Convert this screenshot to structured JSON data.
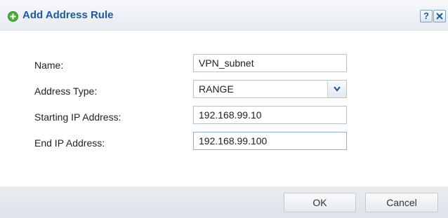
{
  "dialog": {
    "title": "Add Address Rule",
    "help_label": "?",
    "close_label": "X"
  },
  "form": {
    "name": {
      "label": "Name:",
      "value": "VPN_subnet"
    },
    "address_type": {
      "label": "Address Type:",
      "value": "RANGE"
    },
    "starting_ip": {
      "label": "Starting IP Address:",
      "value": "192.168.99.10"
    },
    "end_ip": {
      "label": "End IP Address:",
      "value": "192.168.99.100"
    }
  },
  "footer": {
    "ok_label": "OK",
    "cancel_label": "Cancel"
  },
  "colors": {
    "title_text": "#1b5aa0",
    "add_icon": "#4caf3a",
    "footer_bg": "#e3e8ee"
  },
  "icons": {
    "title": "add-circle-icon",
    "dropdown": "chevron-down-icon",
    "close": "close-icon"
  }
}
